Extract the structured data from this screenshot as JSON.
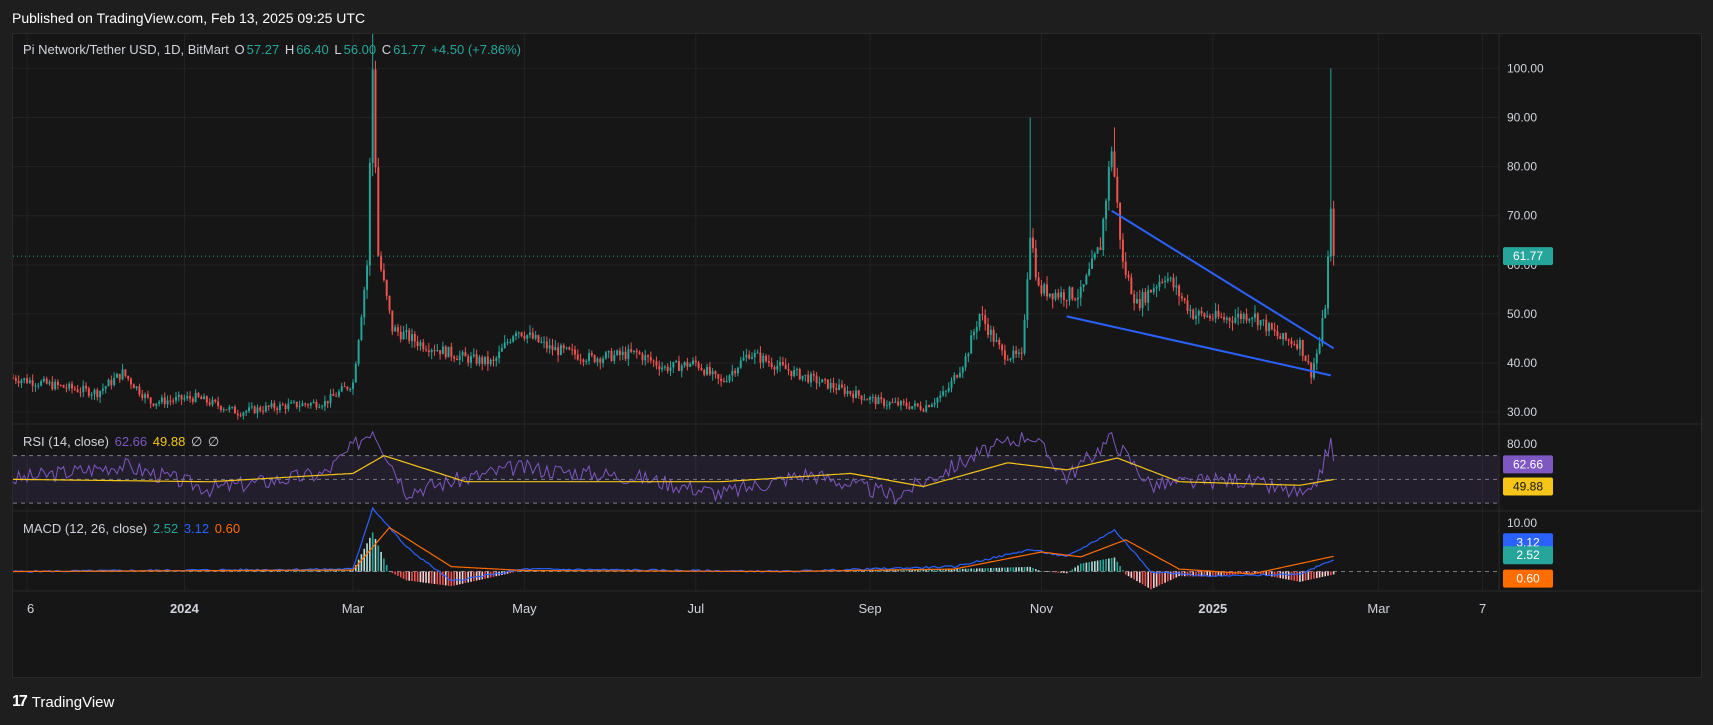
{
  "published": "Published on TradingView.com, Feb 13, 2025 09:25 UTC",
  "legend": {
    "symbol": "Pi Network/Tether USD, 1D, BitMart",
    "o_label": "O",
    "o_val": "57.27",
    "h_label": "H",
    "h_val": "66.40",
    "l_label": "L",
    "l_val": "56.00",
    "c_label": "C",
    "c_val": "61.77",
    "change": "+4.50 (+7.86%)"
  },
  "rsi_legend": {
    "label": "RSI (14, close)",
    "v1": "62.66",
    "v2": "49.88",
    "v3": "∅",
    "v4": "∅"
  },
  "macd_legend": {
    "label": "MACD (12, 26, close)",
    "v1": "2.52",
    "v2": "3.12",
    "v3": "0.60"
  },
  "footer": {
    "brand": "TradingView",
    "logo": "17"
  },
  "colors": {
    "up": "#26a69a",
    "down": "#ef5350",
    "rsi": "#7e57c2",
    "rsi_ma": "#f5c518",
    "macd": "#2962ff",
    "signal": "#ff6d00",
    "trendline": "#2962ff"
  },
  "chart_data": [
    {
      "type": "candlestick",
      "title": "Pi Network/Tether USD, 1D, BitMart",
      "y_ticks": [
        30,
        40,
        50,
        60,
        70,
        80,
        90,
        100
      ],
      "y_tick_labels": [
        "30.00",
        "40.00",
        "50.00",
        "60.00",
        "70.00",
        "80.00",
        "90.00",
        "100.00"
      ],
      "ylim": [
        28,
        107
      ],
      "last_price": 61.77,
      "last_price_label": "61.77",
      "x_tick_labels": [
        "6",
        "2024",
        "Mar",
        "May",
        "Jul",
        "Sep",
        "Nov",
        "2025",
        "Mar",
        "7"
      ],
      "x_tick_dates": [
        "2023-11-06",
        "2024-01-01",
        "2024-03-01",
        "2024-05-01",
        "2024-07-01",
        "2024-09-01",
        "2024-11-01",
        "2025-01-01",
        "2025-03-01",
        "2025-04-07"
      ],
      "xlim": [
        "2023-11-01",
        "2025-04-10"
      ],
      "price_path": [
        [
          "2023-11-01",
          37
        ],
        [
          "2023-11-20",
          35
        ],
        [
          "2023-12-01",
          34
        ],
        [
          "2023-12-10",
          38
        ],
        [
          "2023-12-20",
          32
        ],
        [
          "2024-01-05",
          33
        ],
        [
          "2024-01-20",
          30
        ],
        [
          "2024-02-01",
          31
        ],
        [
          "2024-02-20",
          32
        ],
        [
          "2024-03-01",
          36
        ],
        [
          "2024-03-06",
          60
        ],
        [
          "2024-03-08",
          100
        ],
        [
          "2024-03-10",
          62
        ],
        [
          "2024-03-15",
          47
        ],
        [
          "2024-03-25",
          44
        ],
        [
          "2024-04-10",
          41
        ],
        [
          "2024-04-20",
          40
        ],
        [
          "2024-04-28",
          47
        ],
        [
          "2024-05-10",
          43
        ],
        [
          "2024-05-25",
          41
        ],
        [
          "2024-06-10",
          42
        ],
        [
          "2024-06-20",
          39
        ],
        [
          "2024-07-01",
          40
        ],
        [
          "2024-07-10",
          36
        ],
        [
          "2024-07-20",
          42
        ],
        [
          "2024-08-05",
          38
        ],
        [
          "2024-08-25",
          34
        ],
        [
          "2024-09-05",
          32
        ],
        [
          "2024-09-20",
          31
        ],
        [
          "2024-09-28",
          34
        ],
        [
          "2024-10-05",
          41
        ],
        [
          "2024-10-10",
          50
        ],
        [
          "2024-10-18",
          42
        ],
        [
          "2024-10-25",
          41
        ],
        [
          "2024-10-28",
          67
        ],
        [
          "2024-10-31",
          55
        ],
        [
          "2024-11-08",
          54
        ],
        [
          "2024-11-15",
          54
        ],
        [
          "2024-11-22",
          64
        ],
        [
          "2024-11-26",
          84
        ],
        [
          "2024-11-30",
          60
        ],
        [
          "2024-12-05",
          52
        ],
        [
          "2024-12-15",
          58
        ],
        [
          "2024-12-25",
          50
        ],
        [
          "2025-01-05",
          49
        ],
        [
          "2025-01-15",
          50
        ],
        [
          "2025-01-25",
          45
        ],
        [
          "2025-02-01",
          44
        ],
        [
          "2025-02-05",
          38
        ],
        [
          "2025-02-08",
          44
        ],
        [
          "2025-02-10",
          52
        ],
        [
          "2025-02-12",
          70
        ],
        [
          "2025-02-13",
          61.77
        ]
      ],
      "spike_highs": [
        [
          "2024-03-08",
          107
        ],
        [
          "2024-10-28",
          90
        ],
        [
          "2024-11-27",
          88
        ],
        [
          "2025-02-12",
          100
        ]
      ],
      "falling_wedge": {
        "upper": [
          [
            "2024-11-26",
            71
          ],
          [
            "2025-02-13",
            43
          ]
        ],
        "lower": [
          [
            "2024-11-10",
            49.5
          ],
          [
            "2025-02-12",
            37.5
          ]
        ]
      }
    },
    {
      "type": "line",
      "title": "RSI (14, close)",
      "y_ticks": [
        80
      ],
      "y_tick_labels": [
        "80.00"
      ],
      "bands": [
        70,
        50,
        30
      ],
      "ylim": [
        25,
        95
      ],
      "series": [
        {
          "name": "RSI",
          "last": 62.66,
          "last_label": "62.66",
          "points": [
            [
              "2023-11-01",
              50
            ],
            [
              "2023-12-10",
              62
            ],
            [
              "2024-01-10",
              42
            ],
            [
              "2024-02-20",
              55
            ],
            [
              "2024-03-08",
              93
            ],
            [
              "2024-03-20",
              40
            ],
            [
              "2024-04-28",
              60
            ],
            [
              "2024-06-10",
              52
            ],
            [
              "2024-07-10",
              38
            ],
            [
              "2024-08-10",
              55
            ],
            [
              "2024-09-10",
              36
            ],
            [
              "2024-10-10",
              72
            ],
            [
              "2024-10-28",
              88
            ],
            [
              "2024-11-10",
              52
            ],
            [
              "2024-11-26",
              85
            ],
            [
              "2024-12-10",
              45
            ],
            [
              "2025-01-10",
              50
            ],
            [
              "2025-02-05",
              35
            ],
            [
              "2025-02-12",
              82
            ],
            [
              "2025-02-13",
              62.66
            ]
          ]
        },
        {
          "name": "RSI-based MA",
          "last": 49.88,
          "last_label": "49.88",
          "points": [
            [
              "2023-11-01",
              50
            ],
            [
              "2024-01-10",
              48
            ],
            [
              "2024-03-01",
              55
            ],
            [
              "2024-03-12",
              70
            ],
            [
              "2024-04-10",
              48
            ],
            [
              "2024-07-10",
              48
            ],
            [
              "2024-08-25",
              55
            ],
            [
              "2024-09-20",
              44
            ],
            [
              "2024-10-20",
              64
            ],
            [
              "2024-11-10",
              58
            ],
            [
              "2024-11-28",
              68
            ],
            [
              "2024-12-20",
              48
            ],
            [
              "2025-02-01",
              45
            ],
            [
              "2025-02-13",
              49.88
            ]
          ]
        }
      ]
    },
    {
      "type": "line",
      "title": "MACD (12, 26, close)",
      "y_ticks": [
        10
      ],
      "y_tick_labels": [
        "10.00"
      ],
      "ylim": [
        -4,
        12
      ],
      "series": [
        {
          "name": "MACD",
          "last": 2.52,
          "last_label": "2.52",
          "points": [
            [
              "2023-11-01",
              0
            ],
            [
              "2024-03-01",
              0.5
            ],
            [
              "2024-03-08",
              13
            ],
            [
              "2024-03-20",
              5
            ],
            [
              "2024-04-05",
              -2
            ],
            [
              "2024-05-01",
              0.5
            ],
            [
              "2024-08-01",
              0
            ],
            [
              "2024-10-01",
              1
            ],
            [
              "2024-10-28",
              4.5
            ],
            [
              "2024-11-10",
              3
            ],
            [
              "2024-11-27",
              8.5
            ],
            [
              "2024-12-10",
              0
            ],
            [
              "2025-01-01",
              -1
            ],
            [
              "2025-02-01",
              -0.5
            ],
            [
              "2025-02-13",
              2.52
            ]
          ]
        },
        {
          "name": "Signal",
          "last": 3.12,
          "last_label": "3.12",
          "points": [
            [
              "2023-11-01",
              0
            ],
            [
              "2024-03-01",
              0.3
            ],
            [
              "2024-03-14",
              9
            ],
            [
              "2024-04-05",
              1
            ],
            [
              "2024-05-01",
              0.2
            ],
            [
              "2024-08-01",
              0
            ],
            [
              "2024-10-01",
              0.5
            ],
            [
              "2024-11-01",
              4
            ],
            [
              "2024-11-15",
              3
            ],
            [
              "2024-12-01",
              6.5
            ],
            [
              "2024-12-20",
              0.5
            ],
            [
              "2025-01-15",
              -0.5
            ],
            [
              "2025-02-13",
              3.12
            ]
          ]
        },
        {
          "name": "Histogram",
          "last": 0.6,
          "last_label": "0.60"
        }
      ]
    }
  ]
}
